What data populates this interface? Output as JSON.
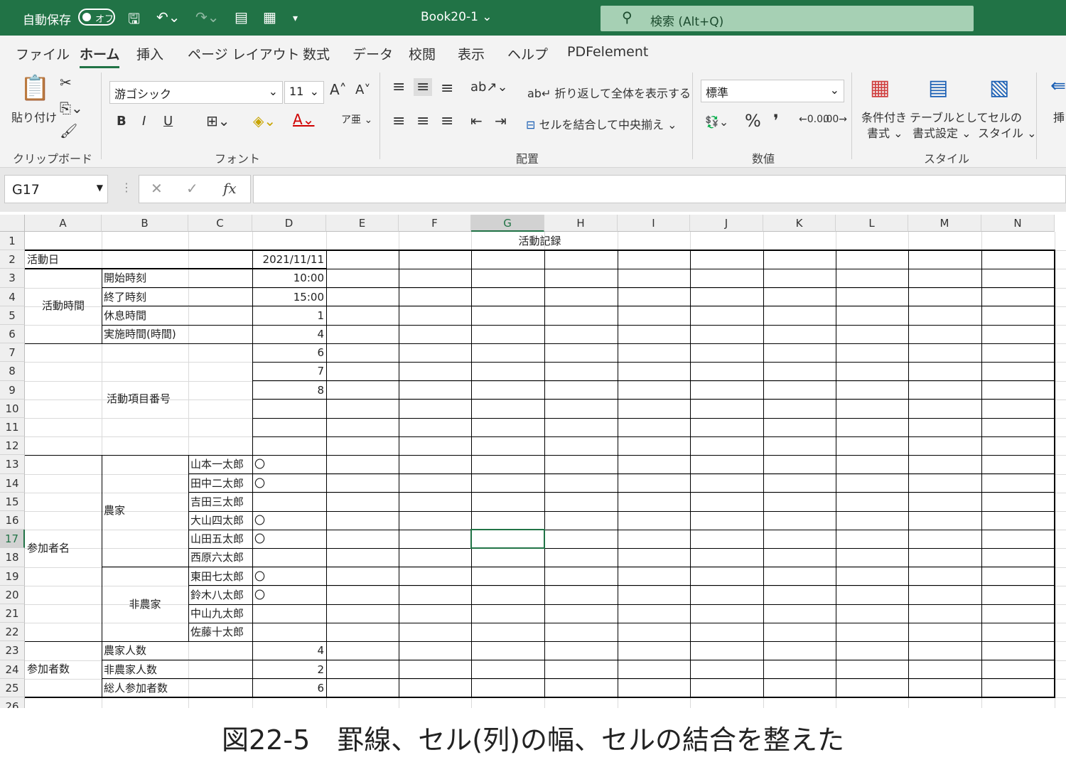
{
  "titlebar": {
    "autosave": "自動保存",
    "toggle": "オフ",
    "doc_title": "Book20-1 ⌄",
    "search_placeholder": "検索 (Alt+Q)"
  },
  "tabs": [
    "ファイル",
    "ホーム",
    "挿入",
    "ページ レイアウト",
    "数式",
    "データ",
    "校閲",
    "表示",
    "ヘルプ",
    "PDFelement"
  ],
  "ribbon": {
    "clipboard": {
      "paste": "貼り付け",
      "label": "クリップボード"
    },
    "font": {
      "name": "游ゴシック",
      "size": "11",
      "label": "フォント",
      "bold": "B",
      "italic": "I",
      "underline": "U"
    },
    "alignment": {
      "wrap": "折り返して全体を表示する",
      "merge": "セルを結合して中央揃え",
      "label": "配置"
    },
    "number": {
      "format": "標準",
      "label": "数値",
      "percent": "%",
      "comma": "❜"
    },
    "styles": {
      "cond1": "条件付き",
      "cond2": "書式 ⌄",
      "table1": "テーブルとして",
      "table2": "書式設定 ⌄",
      "cell1": "セルの",
      "cell2": "スタイル ⌄",
      "label": "スタイル",
      "insert": "挿"
    }
  },
  "formula_bar": {
    "name_box": "G17",
    "fx": "fx"
  },
  "columns": [
    "A",
    "B",
    "C",
    "D",
    "E",
    "F",
    "G",
    "H",
    "I",
    "J",
    "K",
    "L",
    "M",
    "N"
  ],
  "rows": [
    "1",
    "2",
    "3",
    "4",
    "5",
    "6",
    "7",
    "8",
    "9",
    "10",
    "11",
    "12",
    "13",
    "14",
    "15",
    "16",
    "17",
    "18",
    "19",
    "20",
    "21",
    "22",
    "23",
    "24",
    "25",
    "26"
  ],
  "cells": {
    "title": "活動記録",
    "date_label": "活動日",
    "date_value": "2021/11/11",
    "time_group": "活動時間",
    "start_label": "開始時刻",
    "start_value": "10:00",
    "end_label": "終了時刻",
    "end_value": "15:00",
    "break_label": "休息時間",
    "break_value": "1",
    "work_label": "実施時間(時間)",
    "work_value": "4",
    "item_label": "活動項目番号",
    "item1": "6",
    "item2": "7",
    "item3": "8",
    "participants": "参加者名",
    "farmer": "農家",
    "nonfarmer": "非農家",
    "names": [
      "山本一太郎",
      "田中二太郎",
      "吉田三太郎",
      "大山四太郎",
      "山田五太郎",
      "西原六太郎",
      "東田七太郎",
      "鈴木八太郎",
      "中山九太郎",
      "佐藤十太郎"
    ],
    "marks": [
      "〇",
      "〇",
      "",
      "〇",
      "〇",
      "",
      "〇",
      "〇",
      "",
      ""
    ],
    "count_group": "参加者数",
    "farmer_count_label": "農家人数",
    "farmer_count": "4",
    "nonfarmer_count_label": "非農家人数",
    "nonfarmer_count": "2",
    "total_label": "総人参加者数",
    "total": "6"
  },
  "caption": "図22-5　罫線、セル(列)の幅、セルの結合を整えた",
  "colors": {
    "accent": "#217346",
    "search": "#a6d0b4"
  }
}
